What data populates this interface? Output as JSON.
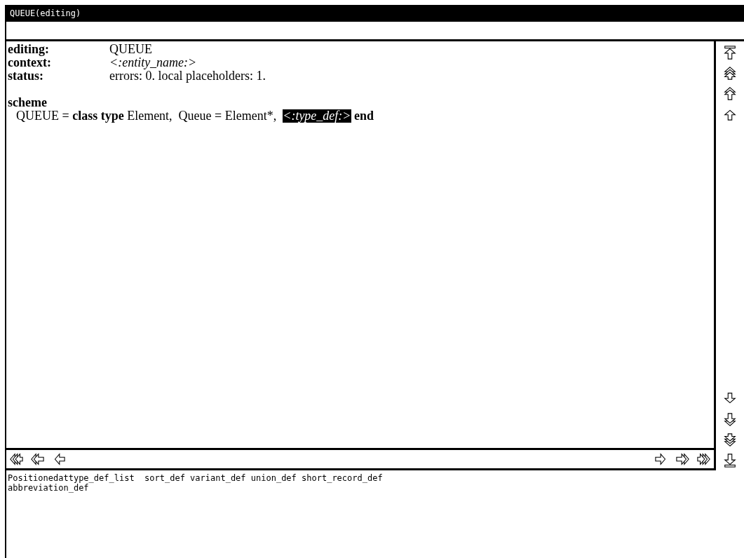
{
  "window": {
    "title": "QUEUE(editing)"
  },
  "header": [
    {
      "label": "editing:",
      "value": "QUEUE",
      "kind": "text"
    },
    {
      "label": "context:",
      "value": "<:entity_name:>",
      "kind": "placeholder"
    },
    {
      "label": "status:",
      "value": "errors: 0.  local placeholders: 1.",
      "kind": "text"
    }
  ],
  "scheme": {
    "heading": "scheme",
    "segments": [
      {
        "text": "QUEUE = ",
        "kind": "text"
      },
      {
        "text": "class type",
        "kind": "keyword"
      },
      {
        "text": " Element,  Queue = Element*,  ",
        "kind": "text"
      },
      {
        "text": "<:type_def:>",
        "kind": "placeholder",
        "selected": true
      },
      {
        "text": " end",
        "kind": "keyword"
      }
    ]
  },
  "bottom_panel": {
    "lines": [
      "Positionedattype_def_list  sort_def variant_def union_def short_record_def",
      "abbreviation_def"
    ]
  }
}
